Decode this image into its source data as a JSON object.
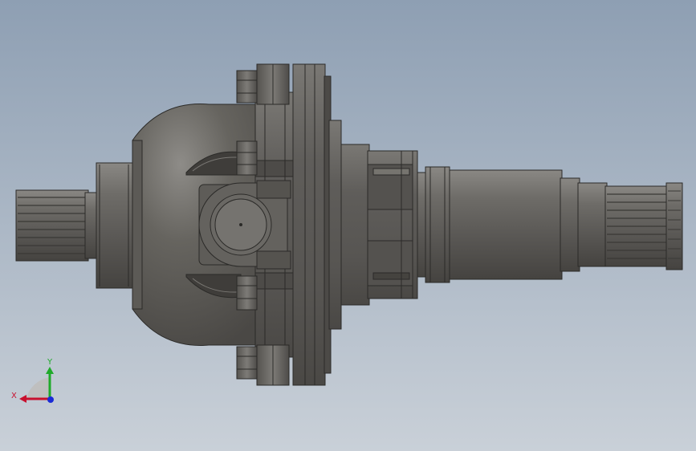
{
  "viewport": {
    "background_top": "#8e9fb3",
    "background_bottom": "#c9d0d8",
    "model_color": "#5d5c59"
  },
  "triad": {
    "x_label": "X",
    "y_label": "Y",
    "x_color": "#c8102e",
    "y_color": "#1faa2a",
    "z_color": "#1a2bd6"
  }
}
